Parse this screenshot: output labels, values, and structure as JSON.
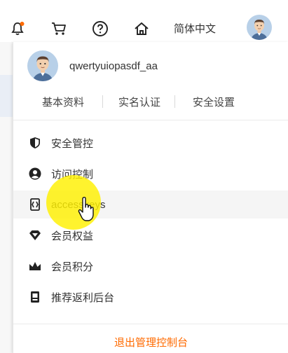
{
  "topbar": {
    "icons": [
      {
        "name": "bell-icon",
        "badge_color": "#ff6a00"
      },
      {
        "name": "cart-icon"
      },
      {
        "name": "help-icon"
      },
      {
        "name": "home-icon"
      }
    ],
    "language_label": "简体中文",
    "avatar": "user-avatar"
  },
  "user": {
    "username": "qwertyuiopasdf_aa"
  },
  "account_links": [
    "基本资料",
    "实名认证",
    "安全设置"
  ],
  "menu": [
    {
      "icon": "shield-icon",
      "label": "安全管控"
    },
    {
      "icon": "user-icon",
      "label": "访问控制"
    },
    {
      "icon": "accesskey-icon",
      "label": "accesskeys"
    },
    {
      "icon": "diamond-icon",
      "label": "会员权益"
    },
    {
      "icon": "crown-icon",
      "label": "会员积分"
    },
    {
      "icon": "rebate-icon",
      "label": "推荐返利后台"
    }
  ],
  "logout_label": "退出管理控制台",
  "colors": {
    "accent": "#ff6a00",
    "cursor_highlight": "#fff000"
  }
}
